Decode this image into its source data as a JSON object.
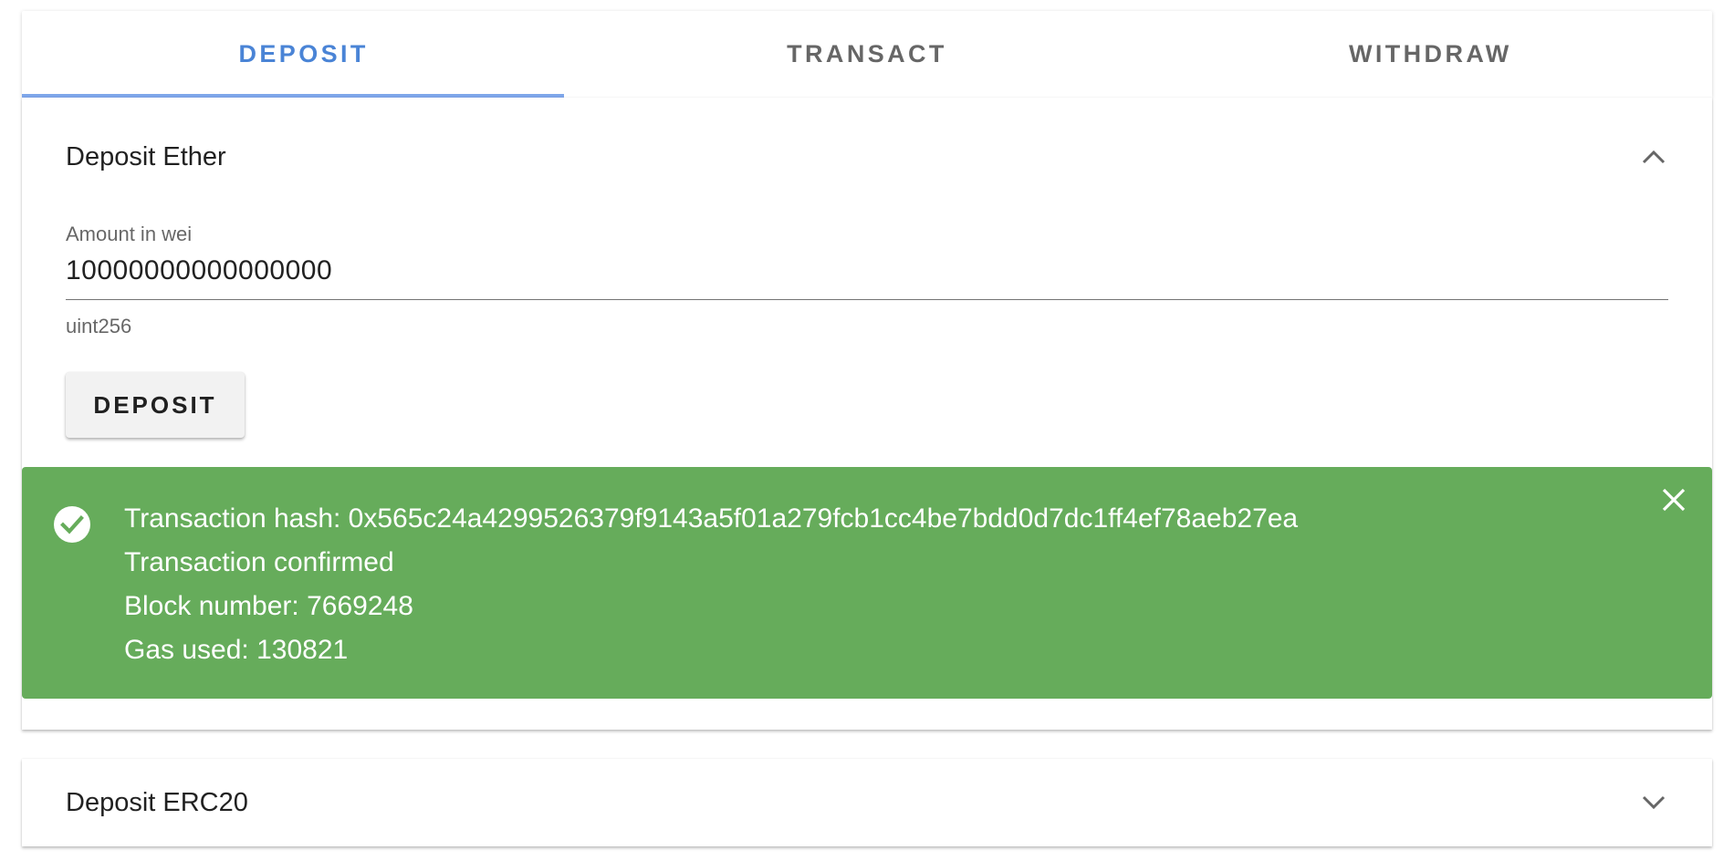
{
  "tabs": [
    {
      "label": "DEPOSIT",
      "active": true
    },
    {
      "label": "TRANSACT",
      "active": false
    },
    {
      "label": "WITHDRAW",
      "active": false
    }
  ],
  "deposit_ether": {
    "title": "Deposit Ether",
    "expanded_icon": "chevron-up-icon",
    "amount_field": {
      "label": "Amount in wei",
      "value": "10000000000000000",
      "helper": "uint256"
    },
    "button_label": "DEPOSIT"
  },
  "alert": {
    "icon": "check-circle-icon",
    "close_icon": "close-icon",
    "color": "#66ac5b",
    "lines": [
      "Transaction hash: 0x565c24a4299526379f9143a5f01a279fcb1cc4be7bdd0d7dc1ff4ef78aeb27ea",
      "Transaction confirmed",
      "Block number: 7669248",
      "Gas used: 130821"
    ]
  },
  "deposit_erc20": {
    "title": "Deposit ERC20",
    "collapsed_icon": "chevron-down-icon"
  },
  "colors": {
    "accent": "#4a84d6",
    "success": "#66ac5b"
  }
}
